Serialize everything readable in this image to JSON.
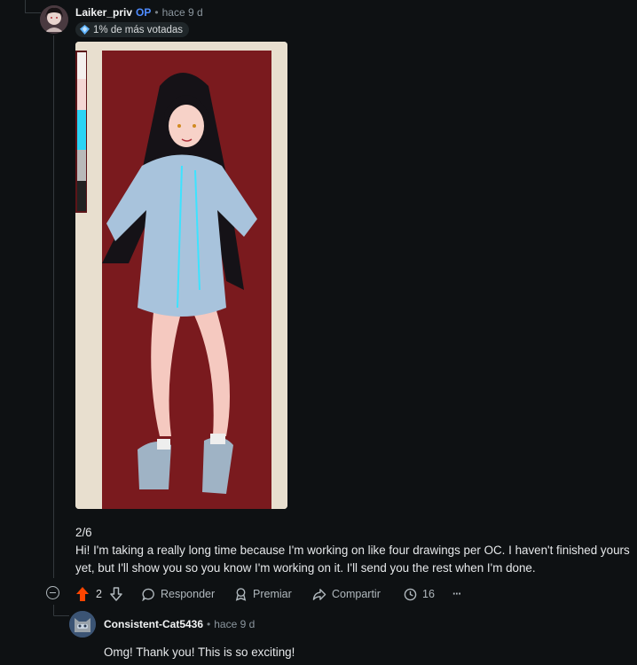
{
  "comment": {
    "author": "Laiker_priv",
    "op_label": "OP",
    "separator": "•",
    "time": "hace 9 d",
    "badge": "1% de más votadas",
    "image_index": "2/6",
    "body": "Hi! I'm taking a really long time because I'm working on like four drawings per OC. I haven't finished yours yet, but I'll show you so you know I'm working on it. I'll send you the rest when I'm done.",
    "votes": "2",
    "actions": {
      "reply": "Responder",
      "award": "Premiar",
      "share": "Compartir",
      "views": "16",
      "more": "···"
    }
  },
  "reply": {
    "author": "Consistent-Cat5436",
    "separator": "•",
    "time": "hace 9 d",
    "body": "Omg! Thank you! This is so exciting!"
  },
  "colors": {
    "background": "#0e1113",
    "upvote_active": "#ff4500",
    "op": "#4f8cff",
    "artwork_backdrop": "#7a1a1e"
  }
}
